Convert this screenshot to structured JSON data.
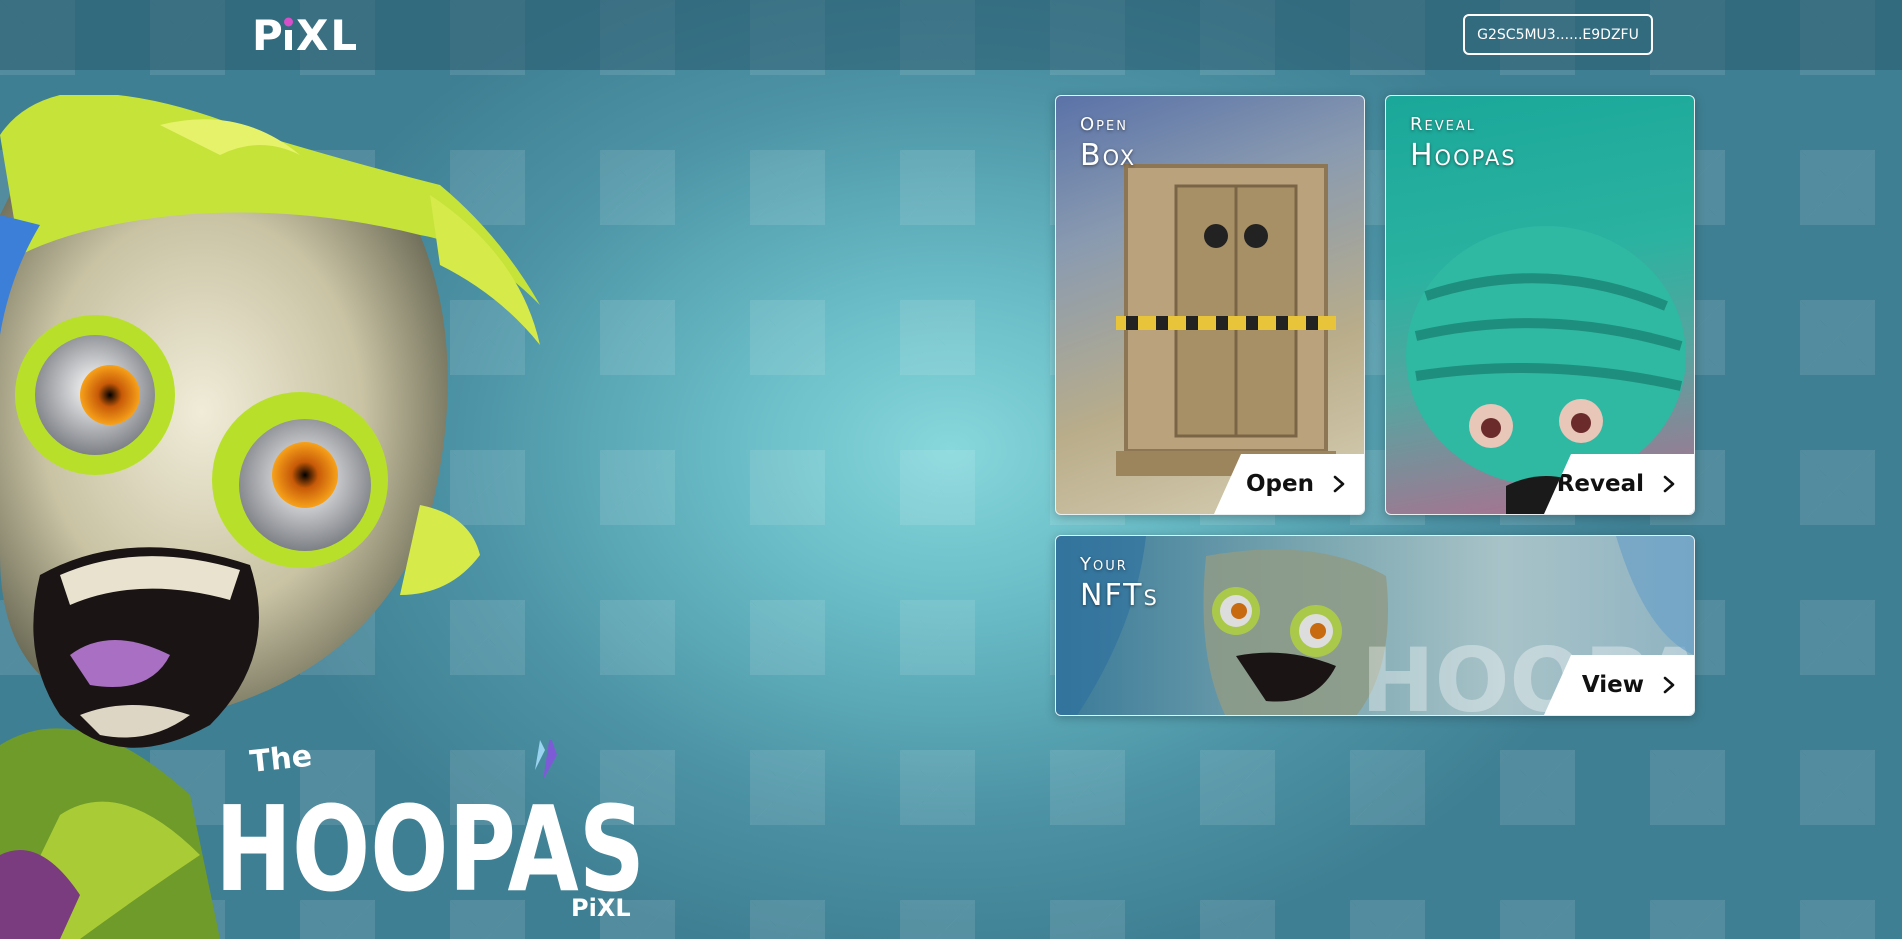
{
  "header": {
    "logo_text": "PiXL",
    "wallet_address": "G2SC5MU3......E9DZFU"
  },
  "cards": {
    "open_box": {
      "label_top": "Open",
      "label_main": "Box",
      "button_label": "Open",
      "icon": "chevron-right-icon"
    },
    "reveal_hoopas": {
      "label_top": "Reveal",
      "label_main": "Hoopas",
      "button_label": "Reveal",
      "icon": "chevron-right-icon"
    },
    "your_nfts": {
      "label_top": "Your",
      "label_main": "NFTs",
      "button_label": "View",
      "icon": "chevron-right-icon"
    }
  },
  "hero": {
    "title_small": "The",
    "title_big": "HOOPAS",
    "sub_logo": "PiXL"
  },
  "colors": {
    "accent": "#d64ec8",
    "bg_top": "#3f7f93",
    "bg_center": "#86d8dc"
  }
}
